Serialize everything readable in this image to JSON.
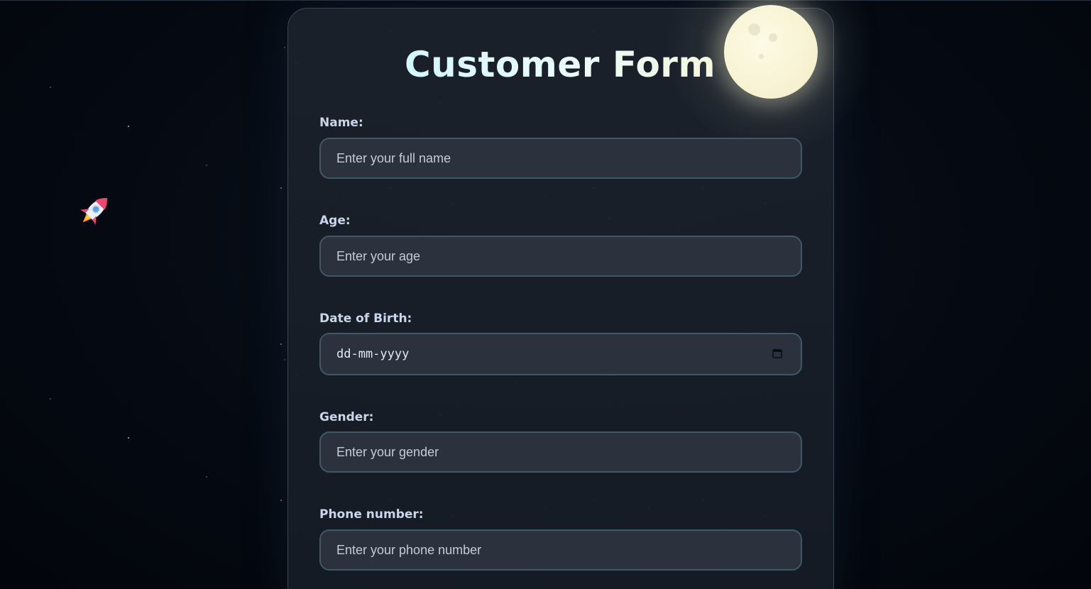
{
  "title": "Customer Form",
  "fields": [
    {
      "label": "Name:",
      "placeholder": "Enter your full name"
    },
    {
      "label": "Age:",
      "placeholder": "Enter your age"
    },
    {
      "label": "Date of Birth:",
      "placeholder": "dd-mm-yyyy"
    },
    {
      "label": "Gender:",
      "placeholder": "Enter your gender"
    },
    {
      "label": "Phone number:",
      "placeholder": "Enter your phone number"
    }
  ],
  "icons": {
    "rocket": "rocket-icon",
    "moon": "moon-icon",
    "calendar": "calendar-icon"
  },
  "colors": {
    "background": "#02050b",
    "card": "#1c222c",
    "input_bg": "#2b323d",
    "input_border": "#3f5866",
    "label": "#c9d6ea"
  }
}
